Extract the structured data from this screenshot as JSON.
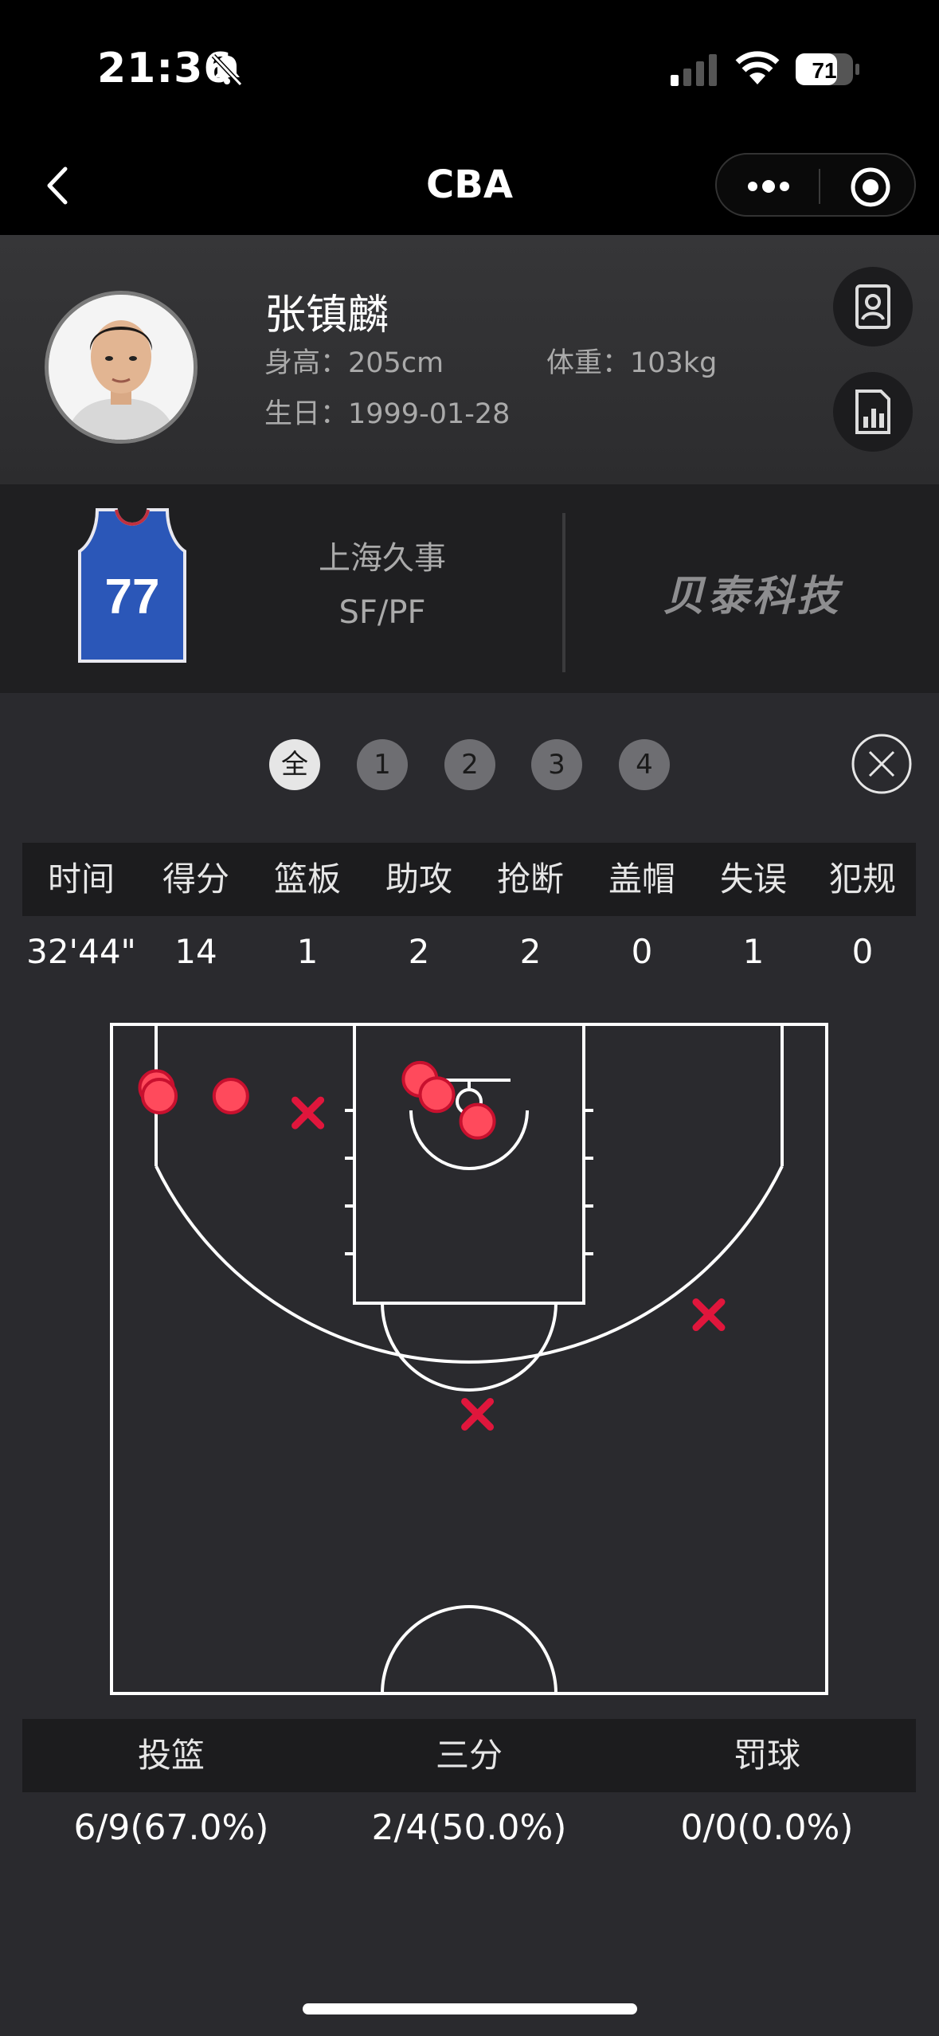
{
  "status_bar": {
    "time": "21:36",
    "battery": "71"
  },
  "nav": {
    "title": "CBA"
  },
  "player": {
    "name": "张镇麟",
    "height": "身高：205cm",
    "weight": "体重：103kg",
    "birthday": "生日：1999-01-28",
    "jersey_number": "77"
  },
  "team": {
    "name": "上海久事",
    "position": "SF/PF",
    "sponsor": "贝泰科技"
  },
  "periods": [
    {
      "label": "全",
      "active": true
    },
    {
      "label": "1",
      "active": false
    },
    {
      "label": "2",
      "active": false
    },
    {
      "label": "3",
      "active": false
    },
    {
      "label": "4",
      "active": false
    }
  ],
  "stats": {
    "headers": [
      "时间",
      "得分",
      "篮板",
      "助攻",
      "抢断",
      "盖帽",
      "失误",
      "犯规"
    ],
    "values": [
      "32'44\"",
      "14",
      "1",
      "2",
      "2",
      "0",
      "1",
      "0"
    ]
  },
  "shot_chart": {
    "made_color": "#ff4a5c",
    "missed_color": "#e0163c",
    "shots": [
      {
        "result": "made",
        "x": -22.3,
        "y": 1.0
      },
      {
        "result": "made",
        "x": -22.1,
        "y": 0.4
      },
      {
        "result": "made",
        "x": -17.0,
        "y": 0.4
      },
      {
        "result": "missed",
        "x": -11.5,
        "y": -0.8
      },
      {
        "result": "made",
        "x": -3.5,
        "y": 1.6
      },
      {
        "result": "made",
        "x": -2.3,
        "y": 0.5
      },
      {
        "result": "made",
        "x": 0.6,
        "y": -1.4
      },
      {
        "result": "missed",
        "x": 17.1,
        "y": -15.2
      },
      {
        "result": "missed",
        "x": 0.6,
        "y": -22.3
      }
    ]
  },
  "shooting": {
    "headers": [
      "投篮",
      "三分",
      "罚球"
    ],
    "values": [
      "6/9(67.0%)",
      "2/4(50.0%)",
      "0/0(0.0%)"
    ]
  }
}
